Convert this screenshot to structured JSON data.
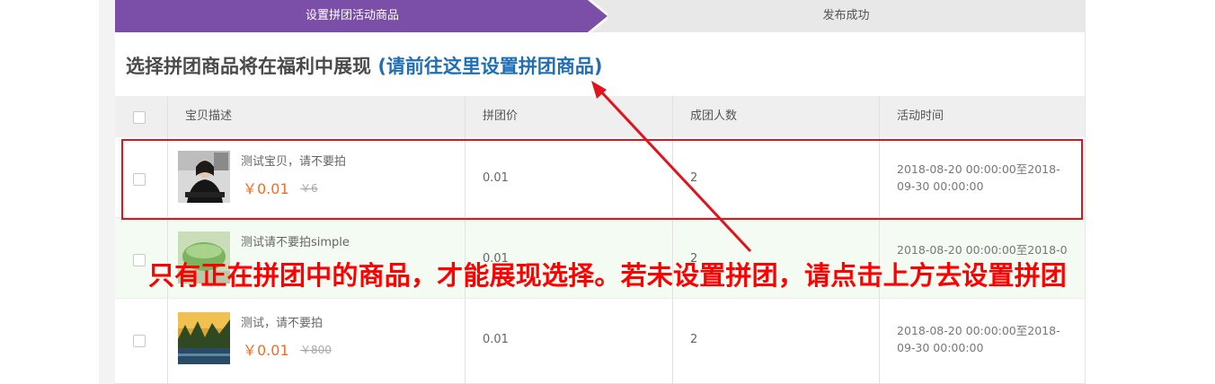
{
  "steps": [
    {
      "label": "设置拼团活动商品",
      "active": true
    },
    {
      "label": "发布成功",
      "active": false
    }
  ],
  "heading": {
    "main": "选择拼团商品将在福利中展现",
    "link": "(请前往这里设置拼团商品)"
  },
  "table": {
    "columns": [
      "宝贝描述",
      "拼团价",
      "成团人数",
      "活动时间"
    ],
    "rows": [
      {
        "name": "测试宝贝，请不要拍",
        "price": "￥0.01",
        "original_price": "￥6",
        "group_price": "0.01",
        "group_size": "2",
        "time": "2018-08-20 00:00:00至2018-09-30 00:00:00",
        "thumb": "woman-portrait-image"
      },
      {
        "name": "测试请不要拍simple",
        "price": "",
        "original_price": "",
        "group_price": "0.01",
        "group_size": "2",
        "time": "2018-08-20 00:00:00至2018-0",
        "thumb": "green-bowl-image"
      },
      {
        "name": "测试，请不要拍",
        "price": "￥0.01",
        "original_price": "￥800",
        "group_price": "0.01",
        "group_size": "2",
        "time": "2018-08-20 00:00:00至2018-09-30 00:00:00",
        "thumb": "landscape-image"
      }
    ]
  },
  "annotation": "只有正在拼团中的商品，才能展现选择。若未设置拼团，请点击上方去设置拼团",
  "colors": {
    "step_active": "#7b4fa8",
    "link": "#1f6fb6",
    "price": "#f26d21",
    "annotation": "#ff0000"
  }
}
